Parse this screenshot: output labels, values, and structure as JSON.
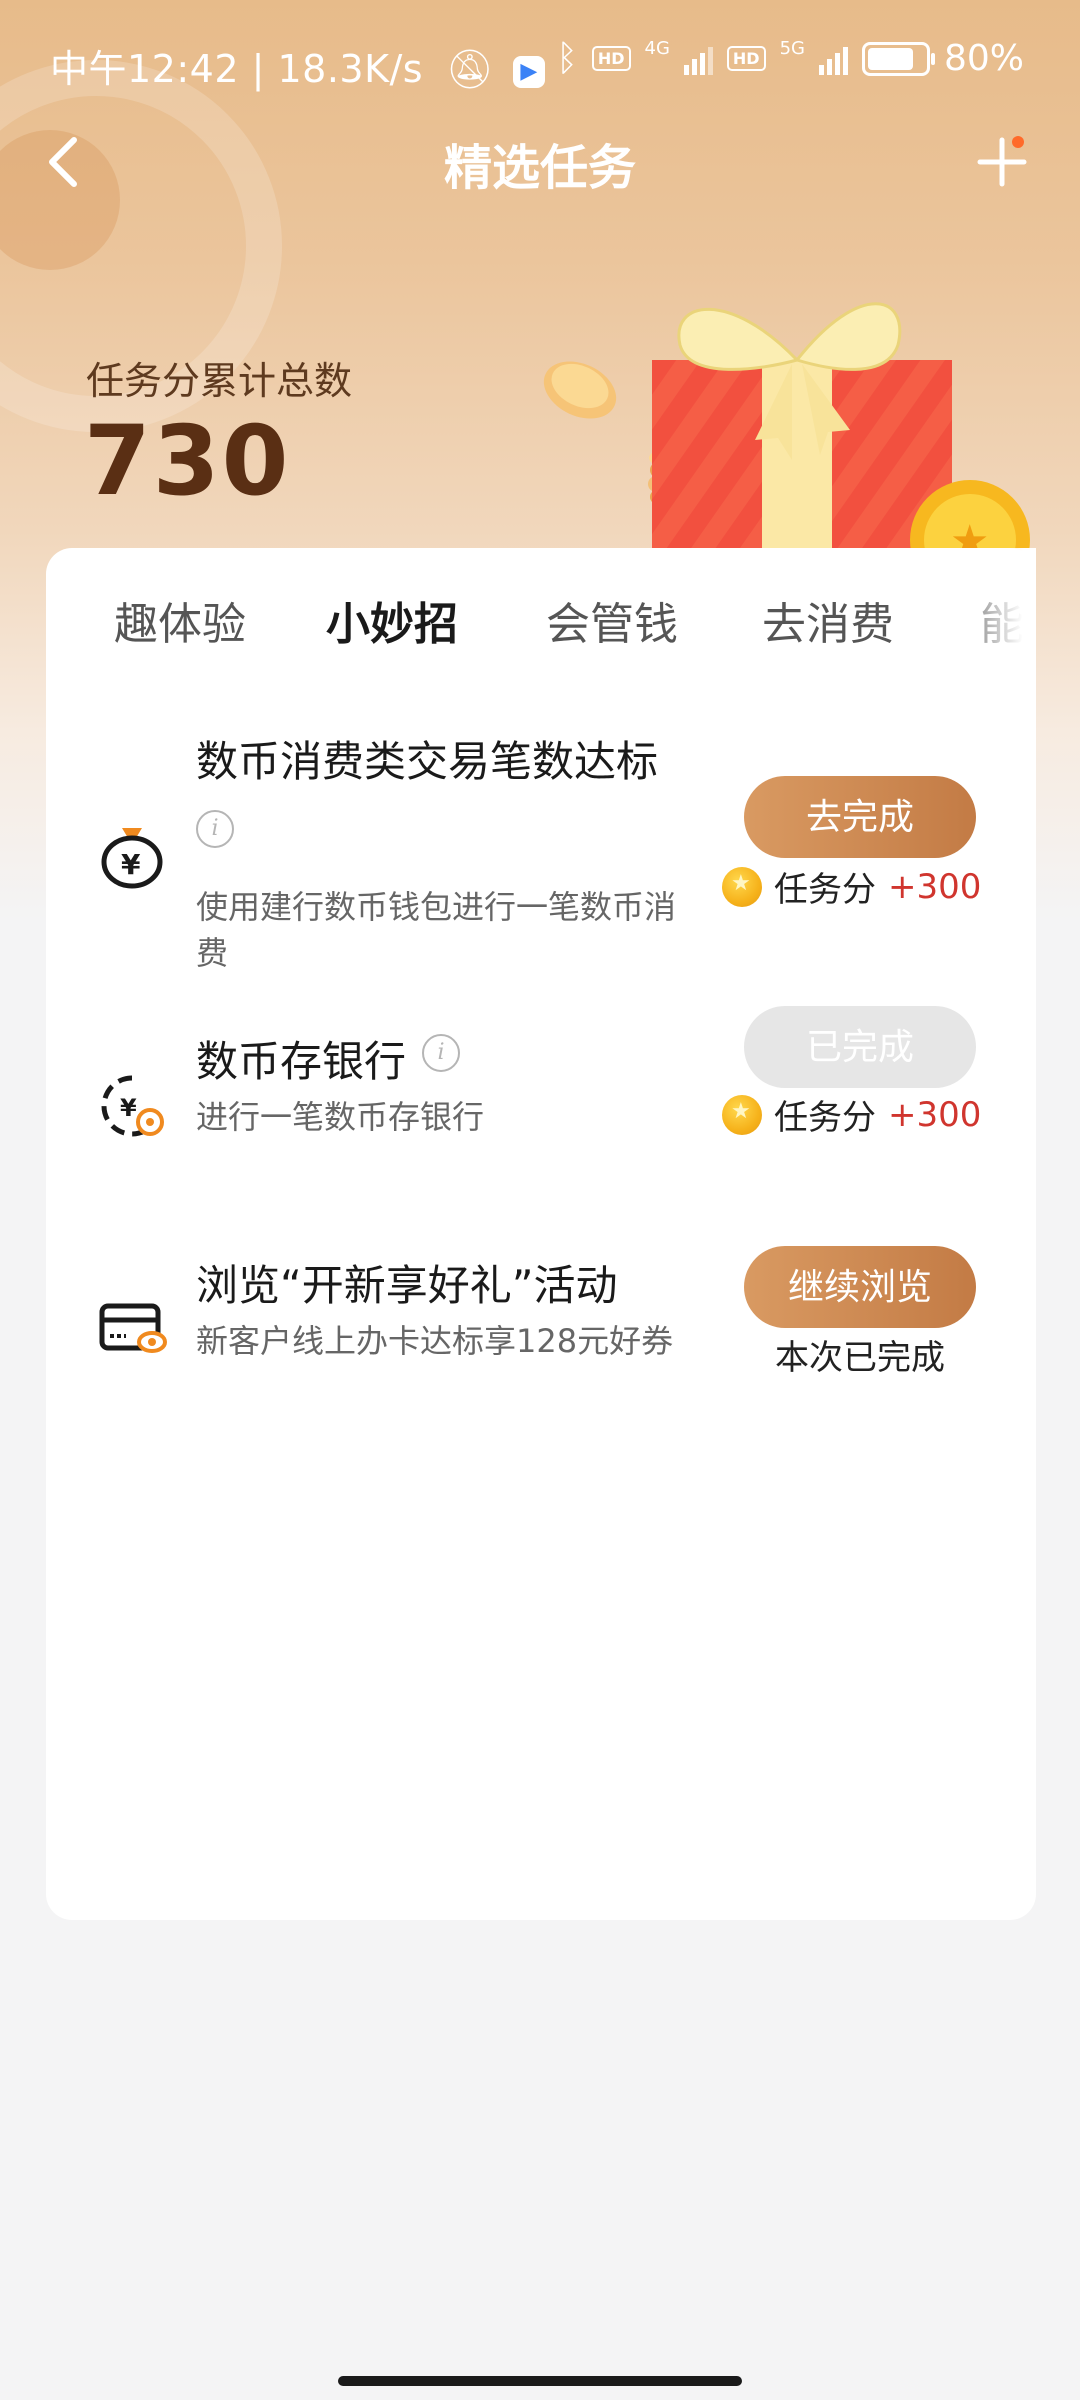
{
  "status_bar": {
    "left": "中午12:42 | 18.3K/s",
    "network_4g": "4G",
    "network_5g": "5G",
    "hd1": "HD",
    "hd2": "HD",
    "battery": "80%",
    "battery_level": 0.8
  },
  "nav": {
    "title": "精选任务",
    "back_icon": "back-arrow-icon",
    "add_icon": "plus-icon"
  },
  "score": {
    "label": "任务分累计总数",
    "value": "730"
  },
  "tabs": [
    {
      "label": "趣体验",
      "active": false
    },
    {
      "label": "小妙招",
      "active": true
    },
    {
      "label": "会管钱",
      "active": false
    },
    {
      "label": "去消费",
      "active": false
    },
    {
      "label": "能",
      "active": false
    }
  ],
  "tasks": [
    {
      "icon": "money-bag-icon",
      "title": "数币消费类交易笔数达标",
      "desc": "使用建行数币钱包进行一笔数币消费",
      "button": "去完成",
      "button_state": "active",
      "reward_label": "任务分",
      "reward_points": "+300"
    },
    {
      "icon": "coin-deposit-icon",
      "title": "数币存银行",
      "desc": "进行一笔数币存银行",
      "button": "已完成",
      "button_state": "done",
      "reward_label": "任务分",
      "reward_points": "+300"
    },
    {
      "icon": "card-view-icon",
      "title": "浏览“开新享好礼”活动",
      "desc": "新客户线上办卡达标享128元好券",
      "button": "继续浏览",
      "button_state": "active",
      "note": "本次已完成"
    }
  ],
  "colors": {
    "accent": "#c37b45",
    "points": "#d0352e",
    "score_text": "#5a2f14"
  }
}
